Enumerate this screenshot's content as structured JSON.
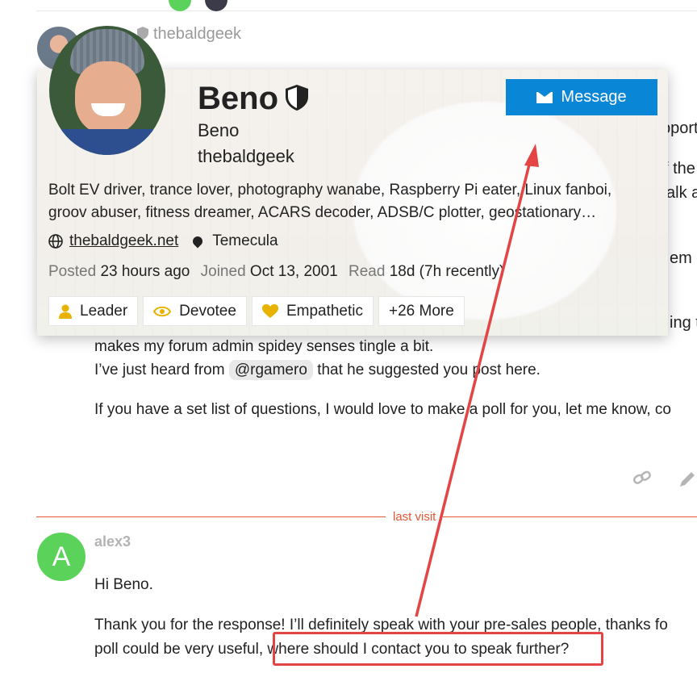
{
  "post1": {
    "username": "thebaldgeek",
    "right_fragments": [
      "pport",
      "f the",
      "alk a",
      "em h",
      "ing t"
    ],
    "line1": "makes my forum admin spidey senses tingle a bit.",
    "line2_before": "I’ve just heard from",
    "line2_mention": "@rgamero",
    "line2_after": "that he suggested you post here.",
    "line3": "If you have a set list of questions, I would love to make a poll for you, let me know, co"
  },
  "user_card": {
    "display_name": "Beno",
    "full_name": "Beno",
    "username": "thebaldgeek",
    "message_button": "Message",
    "bio": "Bolt EV driver, trance lover, photography wanabe, Raspberry Pi eater, Linux fanboi, groov abuser, fitness dreamer, ACARS decoder, ADSB/C plotter, geostationary…",
    "website": "thebaldgeek.net",
    "location": "Temecula",
    "stats": {
      "posted_label": "Posted",
      "posted_value": "23 hours ago",
      "joined_label": "Joined",
      "joined_value": "Oct 13, 2001",
      "read_label": "Read",
      "read_value": "18d (7h recently)"
    },
    "badges": [
      {
        "label": "Leader",
        "icon": "user-icon"
      },
      {
        "label": "Devotee",
        "icon": "eye-icon"
      },
      {
        "label": "Empathetic",
        "icon": "heart-icon"
      },
      {
        "label": "+26 More"
      }
    ]
  },
  "divider": {
    "label": "last visit"
  },
  "post2": {
    "avatar_letter": "A",
    "username": "alex3",
    "greeting": "Hi Beno.",
    "para_line1": "Thank you for the response! I’ll definitely speak with your pre-sales people, thanks fo",
    "para_line2_start": "poll could be very useful,",
    "para_line2_highlight": "where should I contact you to speak further?"
  },
  "colors": {
    "accent": "#0a86d6",
    "last_visit": "#e45735",
    "annotation": "#e34444",
    "alex_avatar": "#5bd35b",
    "badge_gold": "#e8b200"
  }
}
